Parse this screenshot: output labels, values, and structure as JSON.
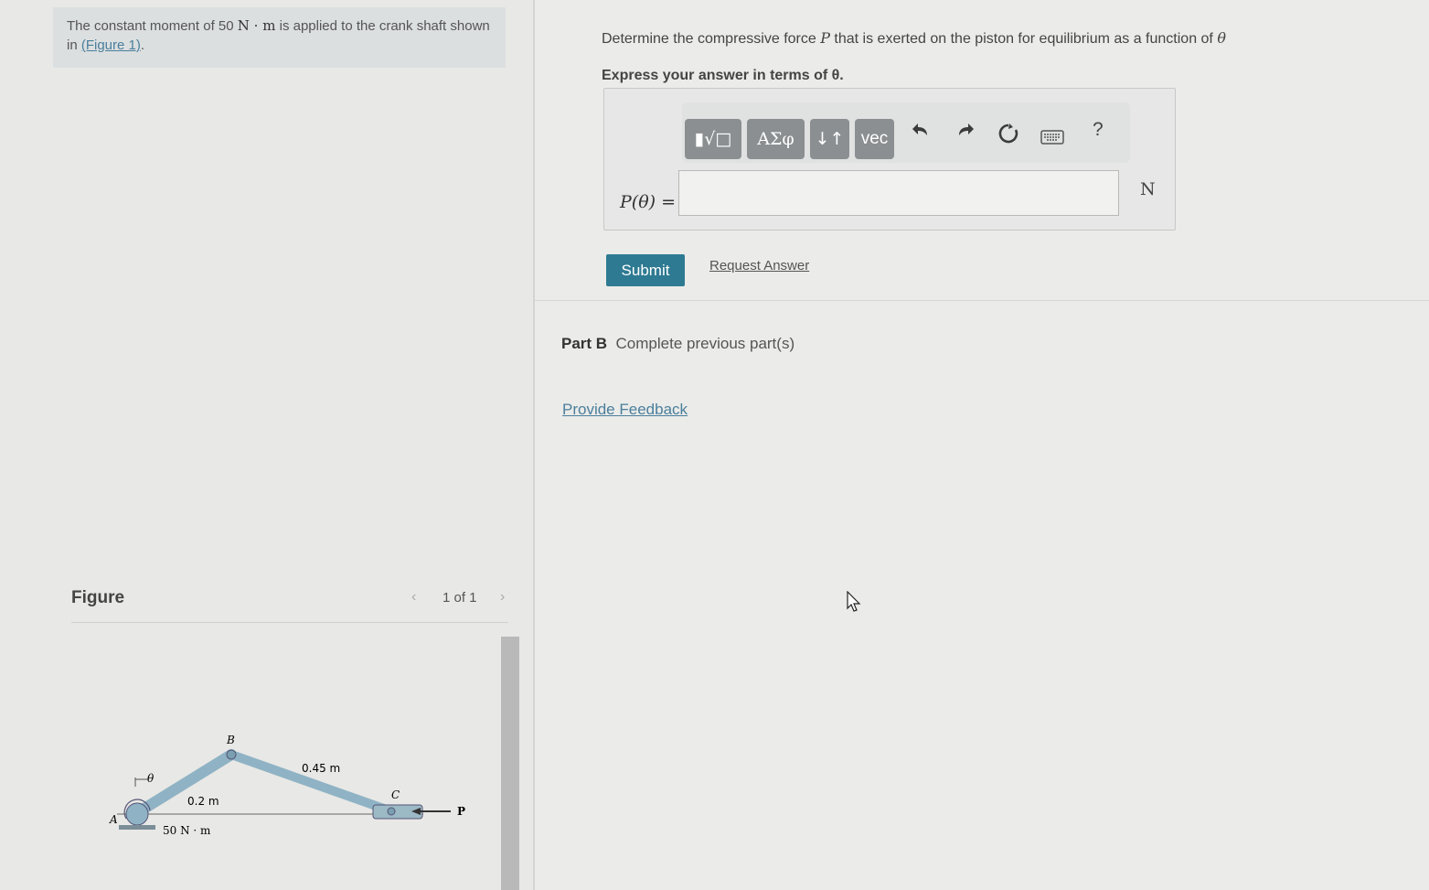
{
  "problem": {
    "intro_before": "The constant moment of 50 ",
    "intro_math": "N · m",
    "intro_after": " is applied to the crank shaft shown in ",
    "figure_link": "(Figure 1)",
    "intro_end": "."
  },
  "part_a": {
    "question_before": "Determine the compressive force ",
    "question_var": "P",
    "question_after": " that is exerted on the piston for equilibrium as a function of ",
    "question_theta": "θ",
    "express": "Express your answer in terms of θ.",
    "toolbar": {
      "template_label": "▮√□",
      "greek_label": "ΑΣφ",
      "sort_label": "↓↑",
      "vec_label": "vec",
      "undo_icon": "undo-icon",
      "redo_icon": "redo-icon",
      "reset_icon": "reset-icon",
      "keyboard_icon": "keyboard-icon",
      "help_label": "?"
    },
    "answer_label": "P(θ) =",
    "answer_value": "",
    "unit": "N",
    "submit_label": "Submit",
    "request_label": "Request Answer"
  },
  "part_b": {
    "label": "Part B",
    "status": "Complete previous part(s)"
  },
  "feedback_label": "Provide Feedback",
  "figure": {
    "title": "Figure",
    "pager": "1 of 1",
    "labels": {
      "b": "B",
      "theta": "θ",
      "bc_length": "0.45 m",
      "ab_length": "0.2 m",
      "c": "C",
      "p": "P",
      "a": "A",
      "moment": "50 N · m"
    }
  }
}
